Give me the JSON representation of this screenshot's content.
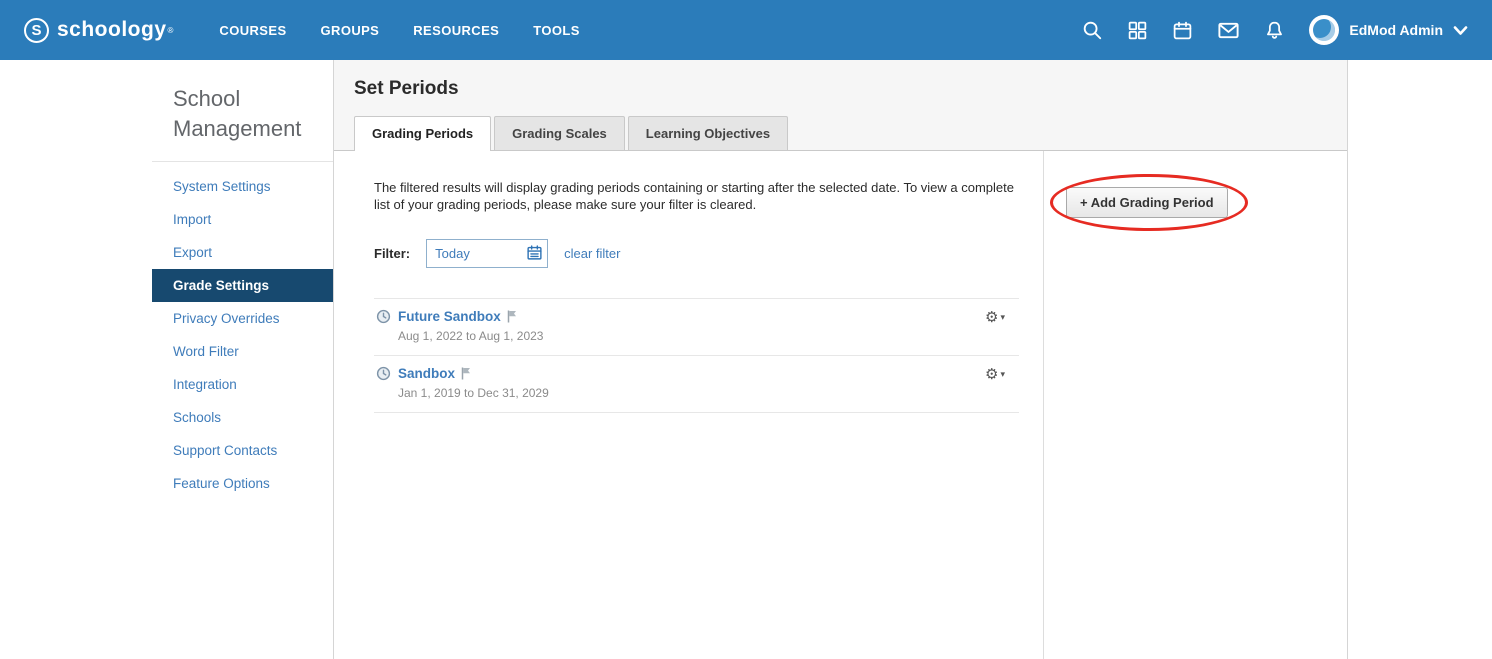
{
  "navbar": {
    "brand": "schoology",
    "brand_mark": "®",
    "links": [
      {
        "label": "COURSES"
      },
      {
        "label": "GROUPS"
      },
      {
        "label": "RESOURCES"
      },
      {
        "label": "TOOLS"
      }
    ],
    "user": "EdMod Admin"
  },
  "sidebar": {
    "title": "School Management",
    "items": [
      {
        "label": "System Settings",
        "active": false
      },
      {
        "label": "Import",
        "active": false
      },
      {
        "label": "Export",
        "active": false
      },
      {
        "label": "Grade Settings",
        "active": true
      },
      {
        "label": "Privacy Overrides",
        "active": false
      },
      {
        "label": "Word Filter",
        "active": false
      },
      {
        "label": "Integration",
        "active": false
      },
      {
        "label": "Schools",
        "active": false
      },
      {
        "label": "Support Contacts",
        "active": false
      },
      {
        "label": "Feature Options",
        "active": false
      }
    ]
  },
  "main": {
    "title": "Set Periods",
    "tabs": [
      {
        "label": "Grading Periods",
        "active": true
      },
      {
        "label": "Grading Scales",
        "active": false
      },
      {
        "label": "Learning Objectives",
        "active": false
      }
    ],
    "description": "The filtered results will display grading periods containing or starting after the selected date. To view a complete list of your grading periods, please make sure your filter is cleared.",
    "filter": {
      "label": "Filter:",
      "value": "Today",
      "clear_label": "clear filter"
    },
    "periods": [
      {
        "name": "Future Sandbox",
        "dates": "Aug 1, 2022 to Aug 1, 2023"
      },
      {
        "name": "Sandbox",
        "dates": "Jan 1, 2019 to Dec 31, 2029"
      }
    ],
    "add_button_label": "+ Add Grading Period"
  },
  "icons": {
    "gear": "⚙",
    "caret": "▾"
  },
  "colors": {
    "navbar_bg": "#2b7cba",
    "link_blue": "#3f7cba",
    "active_item_bg": "#17496f",
    "annotation_red": "#e62b22"
  }
}
